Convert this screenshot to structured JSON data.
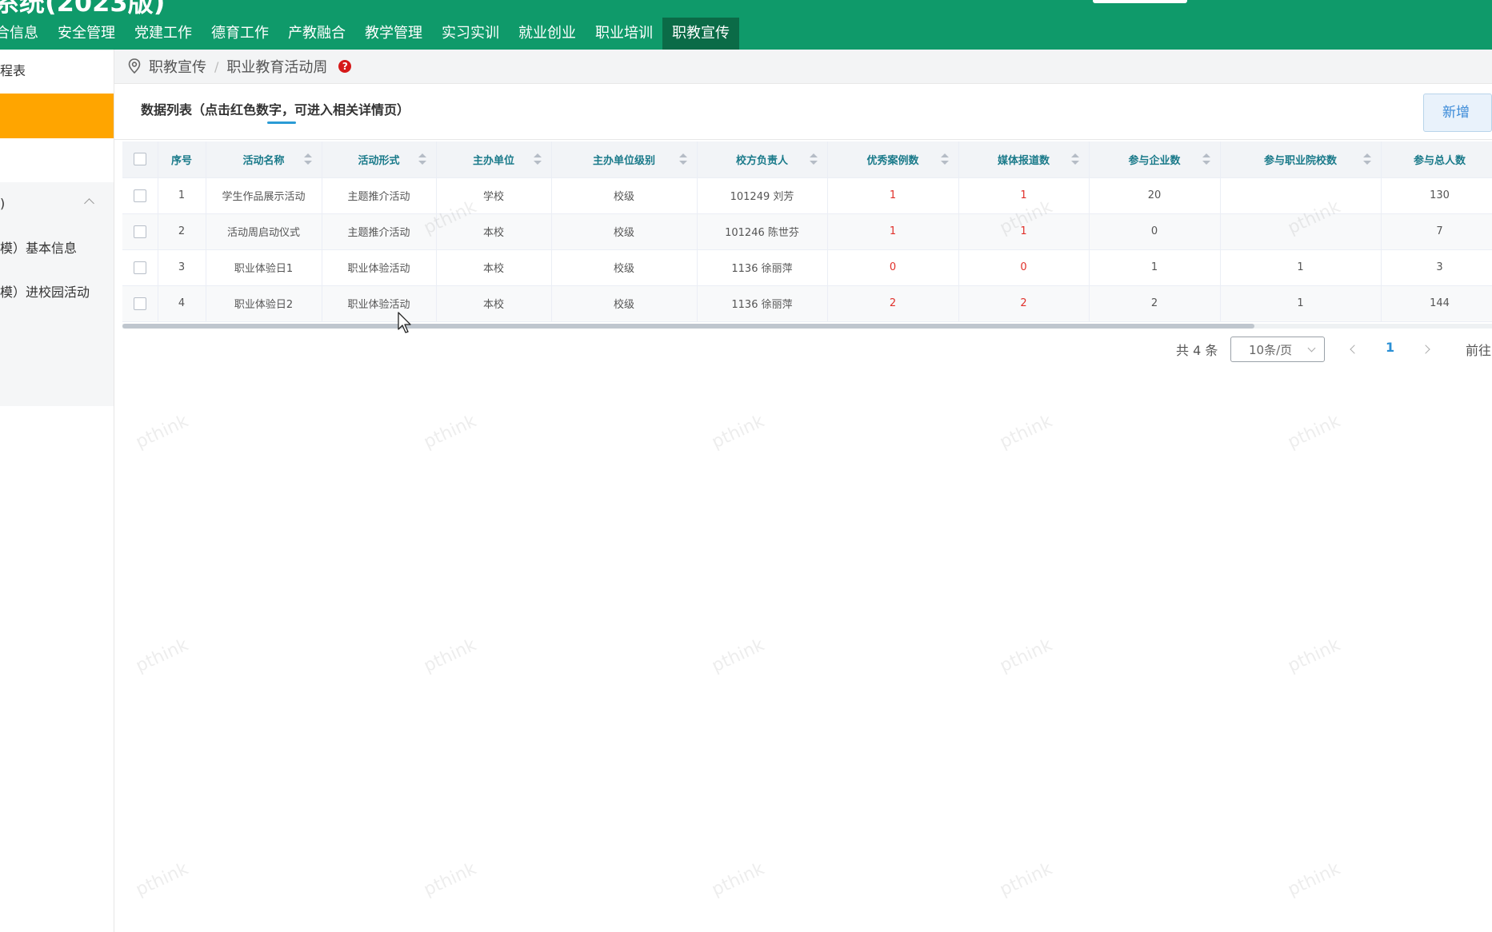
{
  "header": {
    "brand_title": "系统(2023版)",
    "nav": [
      {
        "label": "合信息",
        "active": false
      },
      {
        "label": "安全管理",
        "active": false
      },
      {
        "label": "党建工作",
        "active": false
      },
      {
        "label": "德育工作",
        "active": false
      },
      {
        "label": "产教融合",
        "active": false
      },
      {
        "label": "教学管理",
        "active": false
      },
      {
        "label": "实习实训",
        "active": false
      },
      {
        "label": "就业创业",
        "active": false
      },
      {
        "label": "职业培训",
        "active": false
      },
      {
        "label": "职教宣传",
        "active": true
      }
    ]
  },
  "sidebar": {
    "items": [
      {
        "label": "程表"
      },
      {
        "label": ""
      },
      {
        "label": ")"
      },
      {
        "label": "模）基本信息"
      },
      {
        "label": "模）进校园活动"
      }
    ]
  },
  "breadcrumb": {
    "items": [
      "职教宣传",
      "职业教育活动周"
    ],
    "separator": "/",
    "help": "?"
  },
  "card": {
    "title": "数据列表（点击红色数字，可进入相关详情页）",
    "add_button": "新增"
  },
  "table": {
    "columns": [
      "序号",
      "活动名称",
      "活动形式",
      "主办单位",
      "主办单位级别",
      "校方负责人",
      "优秀案例数",
      "媒体报道数",
      "参与企业数",
      "参与职业院校数",
      "参与总人数"
    ],
    "rows": [
      {
        "no": "1",
        "name": "学生作品展示活动",
        "form": "主题推介活动",
        "host": "学校",
        "level": "校级",
        "leader": "101249 刘芳",
        "cases": "1",
        "media": "1",
        "companies": "20",
        "schools": "",
        "total": "130"
      },
      {
        "no": "2",
        "name": "活动周启动仪式",
        "form": "主题推介活动",
        "host": "本校",
        "level": "校级",
        "leader": "101246 陈世芬",
        "cases": "1",
        "media": "1",
        "companies": "0",
        "schools": "",
        "total": "7"
      },
      {
        "no": "3",
        "name": "职业体验日1",
        "form": "职业体验活动",
        "host": "本校",
        "level": "校级",
        "leader": "1136 徐丽萍",
        "cases": "0",
        "media": "0",
        "companies": "1",
        "schools": "1",
        "total": "3"
      },
      {
        "no": "4",
        "name": "职业体验日2",
        "form": "职业体验活动",
        "host": "本校",
        "level": "校级",
        "leader": "1136 徐丽萍",
        "cases": "2",
        "media": "2",
        "companies": "2",
        "schools": "1",
        "total": "144"
      }
    ]
  },
  "pagination": {
    "total": "共 4 条",
    "page_size": "10条/页",
    "current": "1",
    "goto": "前往"
  },
  "watermark": "pthink",
  "colors": {
    "header_green": "#0f9a6a",
    "nav_active": "#0b6b47",
    "sidebar_active": "#ffa500",
    "link_red": "#e0302a",
    "header_text_teal": "#1a7a8a",
    "accent_blue": "#2a8fd5"
  }
}
